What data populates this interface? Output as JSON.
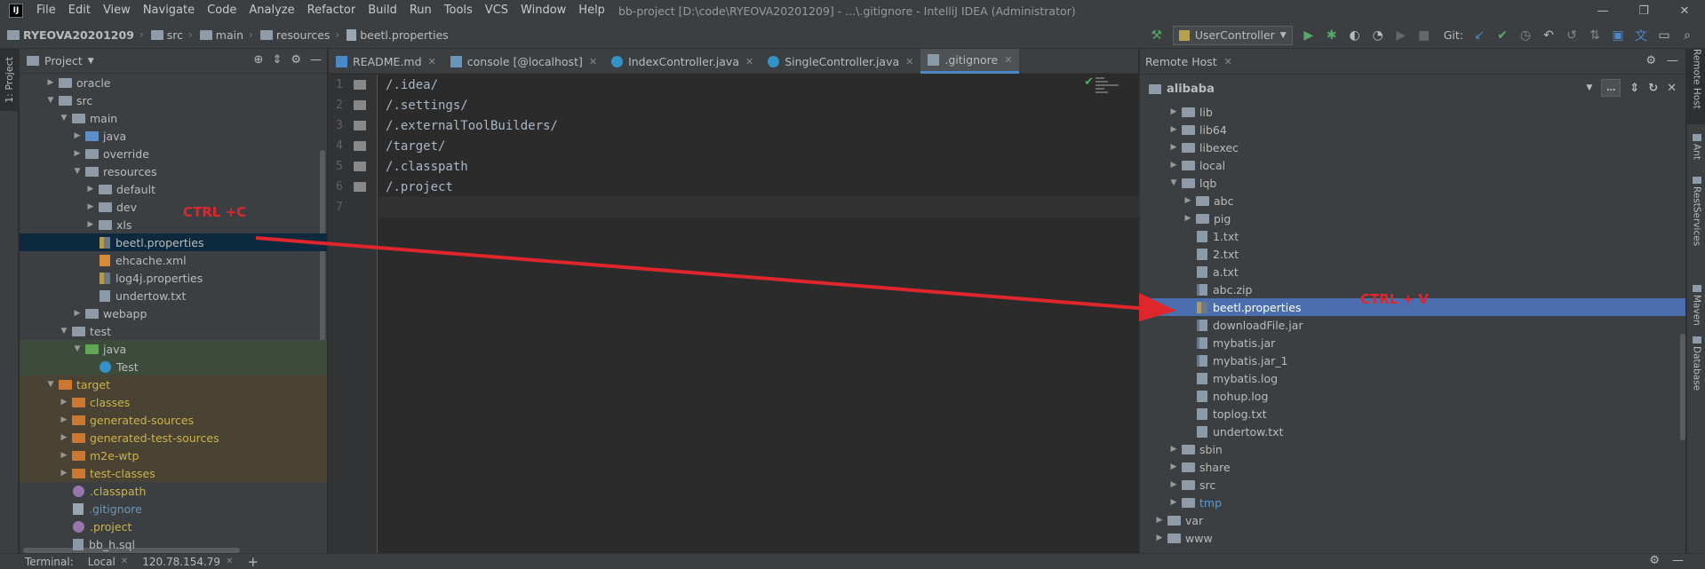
{
  "menubar": {
    "logo": "IJ",
    "items": [
      "File",
      "Edit",
      "View",
      "Navigate",
      "Code",
      "Analyze",
      "Refactor",
      "Build",
      "Run",
      "Tools",
      "VCS",
      "Window",
      "Help"
    ],
    "window_title": "bb-project [D:\\code\\RYEOVA20201209] - ...\\.gitignore - IntelliJ IDEA (Administrator)"
  },
  "navbar": {
    "breadcrumbs": [
      "RYEOVA20201209",
      "src",
      "main",
      "resources",
      "beetl.properties"
    ],
    "run_config": "UserController",
    "git_label": "Git:"
  },
  "left_strip": {
    "project_tab": "1: Project"
  },
  "project_panel": {
    "title": "Project",
    "tree": [
      {
        "label": "oracle",
        "indent": 1,
        "type": "folder",
        "arrow": "▶"
      },
      {
        "label": "src",
        "indent": 1,
        "type": "folder",
        "arrow": "▼"
      },
      {
        "label": "main",
        "indent": 2,
        "type": "folder",
        "arrow": "▼"
      },
      {
        "label": "java",
        "indent": 3,
        "type": "folder-blue",
        "arrow": "▶"
      },
      {
        "label": "override",
        "indent": 3,
        "type": "folder",
        "arrow": "▶"
      },
      {
        "label": "resources",
        "indent": 3,
        "type": "folder",
        "arrow": "▼"
      },
      {
        "label": "default",
        "indent": 4,
        "type": "folder",
        "arrow": "▶"
      },
      {
        "label": "dev",
        "indent": 4,
        "type": "folder",
        "arrow": "▶"
      },
      {
        "label": "xls",
        "indent": 4,
        "type": "folder",
        "arrow": "▶"
      },
      {
        "label": "beetl.properties",
        "indent": 4,
        "type": "props",
        "arrow": "",
        "state": "selected"
      },
      {
        "label": "ehcache.xml",
        "indent": 4,
        "type": "xml",
        "arrow": ""
      },
      {
        "label": "log4j.properties",
        "indent": 4,
        "type": "props",
        "arrow": ""
      },
      {
        "label": "undertow.txt",
        "indent": 4,
        "type": "txt",
        "arrow": ""
      },
      {
        "label": "webapp",
        "indent": 3,
        "type": "folder",
        "arrow": "▶"
      },
      {
        "label": "test",
        "indent": 2,
        "type": "folder",
        "arrow": "▼"
      },
      {
        "label": "java",
        "indent": 3,
        "type": "folder-green",
        "arrow": "▼",
        "state": "green"
      },
      {
        "label": "Test",
        "indent": 4,
        "type": "class",
        "arrow": "",
        "state": "green"
      },
      {
        "label": "target",
        "indent": 1,
        "type": "folder-orange",
        "arrow": "▼",
        "state": "brown",
        "color": "yellow"
      },
      {
        "label": "classes",
        "indent": 2,
        "type": "folder-orange",
        "arrow": "▶",
        "state": "brown",
        "color": "yellow"
      },
      {
        "label": "generated-sources",
        "indent": 2,
        "type": "folder-orange",
        "arrow": "▶",
        "state": "brown",
        "color": "yellow"
      },
      {
        "label": "generated-test-sources",
        "indent": 2,
        "type": "folder-orange",
        "arrow": "▶",
        "state": "brown",
        "color": "yellow"
      },
      {
        "label": "m2e-wtp",
        "indent": 2,
        "type": "folder-orange",
        "arrow": "▶",
        "state": "brown",
        "color": "yellow"
      },
      {
        "label": "test-classes",
        "indent": 2,
        "type": "folder-orange",
        "arrow": "▶",
        "state": "brown",
        "color": "yellow"
      },
      {
        "label": ".classpath",
        "indent": 2,
        "type": "dot",
        "arrow": "",
        "color": "yellow"
      },
      {
        "label": ".gitignore",
        "indent": 2,
        "type": "git",
        "arrow": "",
        "color": "blue"
      },
      {
        "label": ".project",
        "indent": 2,
        "type": "dot",
        "arrow": "",
        "color": "yellow"
      },
      {
        "label": "bb_h.sql",
        "indent": 2,
        "type": "sql",
        "arrow": ""
      }
    ]
  },
  "editor": {
    "tabs": [
      {
        "label": "README.md",
        "icon": "md",
        "active": false
      },
      {
        "label": "console [@localhost]",
        "icon": "db",
        "active": false
      },
      {
        "label": "IndexController.java",
        "icon": "java",
        "active": false
      },
      {
        "label": "SingleController.java",
        "icon": "java",
        "active": false
      },
      {
        "label": ".gitignore",
        "icon": "git",
        "active": true
      }
    ],
    "line_numbers": [
      "1",
      "2",
      "3",
      "4",
      "5",
      "6",
      "7"
    ],
    "lines": [
      "/.idea/",
      "/.settings/",
      "/.externalToolBuilders/",
      "/target/",
      "/.classpath",
      "/.project",
      ""
    ],
    "current_line": 7
  },
  "remote_panel": {
    "title": "Remote Host",
    "host": "alibaba",
    "tree": [
      {
        "label": "lib",
        "indent": 1,
        "type": "folder",
        "arrow": "▶"
      },
      {
        "label": "lib64",
        "indent": 1,
        "type": "folder",
        "arrow": "▶"
      },
      {
        "label": "libexec",
        "indent": 1,
        "type": "folder",
        "arrow": "▶"
      },
      {
        "label": "local",
        "indent": 1,
        "type": "folder",
        "arrow": "▶"
      },
      {
        "label": "lqb",
        "indent": 1,
        "type": "folder",
        "arrow": "▼"
      },
      {
        "label": "abc",
        "indent": 2,
        "type": "folder",
        "arrow": "▶"
      },
      {
        "label": "pig",
        "indent": 2,
        "type": "folder",
        "arrow": "▶"
      },
      {
        "label": "1.txt",
        "indent": 2,
        "type": "txt",
        "arrow": ""
      },
      {
        "label": "2.txt",
        "indent": 2,
        "type": "txt",
        "arrow": ""
      },
      {
        "label": "a.txt",
        "indent": 2,
        "type": "txt",
        "arrow": ""
      },
      {
        "label": "abc.zip",
        "indent": 2,
        "type": "zip",
        "arrow": ""
      },
      {
        "label": "beetl.properties",
        "indent": 2,
        "type": "props",
        "arrow": "",
        "state": "selected-blue"
      },
      {
        "label": "downloadFile.jar",
        "indent": 2,
        "type": "jar",
        "arrow": ""
      },
      {
        "label": "mybatis.jar",
        "indent": 2,
        "type": "jar",
        "arrow": ""
      },
      {
        "label": "mybatis.jar_1",
        "indent": 2,
        "type": "jar",
        "arrow": ""
      },
      {
        "label": "mybatis.log",
        "indent": 2,
        "type": "log",
        "arrow": ""
      },
      {
        "label": "nohup.log",
        "indent": 2,
        "type": "log",
        "arrow": ""
      },
      {
        "label": "toplog.txt",
        "indent": 2,
        "type": "txt",
        "arrow": ""
      },
      {
        "label": "undertow.txt",
        "indent": 2,
        "type": "txt",
        "arrow": ""
      },
      {
        "label": "sbin",
        "indent": 1,
        "type": "folder",
        "arrow": "▶"
      },
      {
        "label": "share",
        "indent": 1,
        "type": "folder",
        "arrow": "▶"
      },
      {
        "label": "src",
        "indent": 1,
        "type": "folder",
        "arrow": "▶"
      },
      {
        "label": "tmp",
        "indent": 1,
        "type": "folder",
        "arrow": "▶",
        "color": "tmp"
      },
      {
        "label": "var",
        "indent": 0,
        "type": "folder",
        "arrow": "▶"
      },
      {
        "label": "www",
        "indent": 0,
        "type": "folder",
        "arrow": "▶"
      }
    ]
  },
  "right_strip": {
    "tabs": [
      "Remote Host",
      "Ant",
      "RestServices",
      "Maven",
      "Database"
    ]
  },
  "bottom_bar": {
    "terminal_label": "Terminal:",
    "tabs": [
      "Local",
      "120.78.154.79"
    ],
    "add": "+"
  },
  "annotations": {
    "copy_label": "CTRL +C",
    "paste_label": "CTRL + V",
    "arrow_color": "#e0262d"
  },
  "colors": {
    "accent": "#4a88c7",
    "selection_dark": "#0d293e",
    "selection_blue": "#4b6eaf",
    "background": "#2b2b2b",
    "panel": "#3c3f41"
  }
}
